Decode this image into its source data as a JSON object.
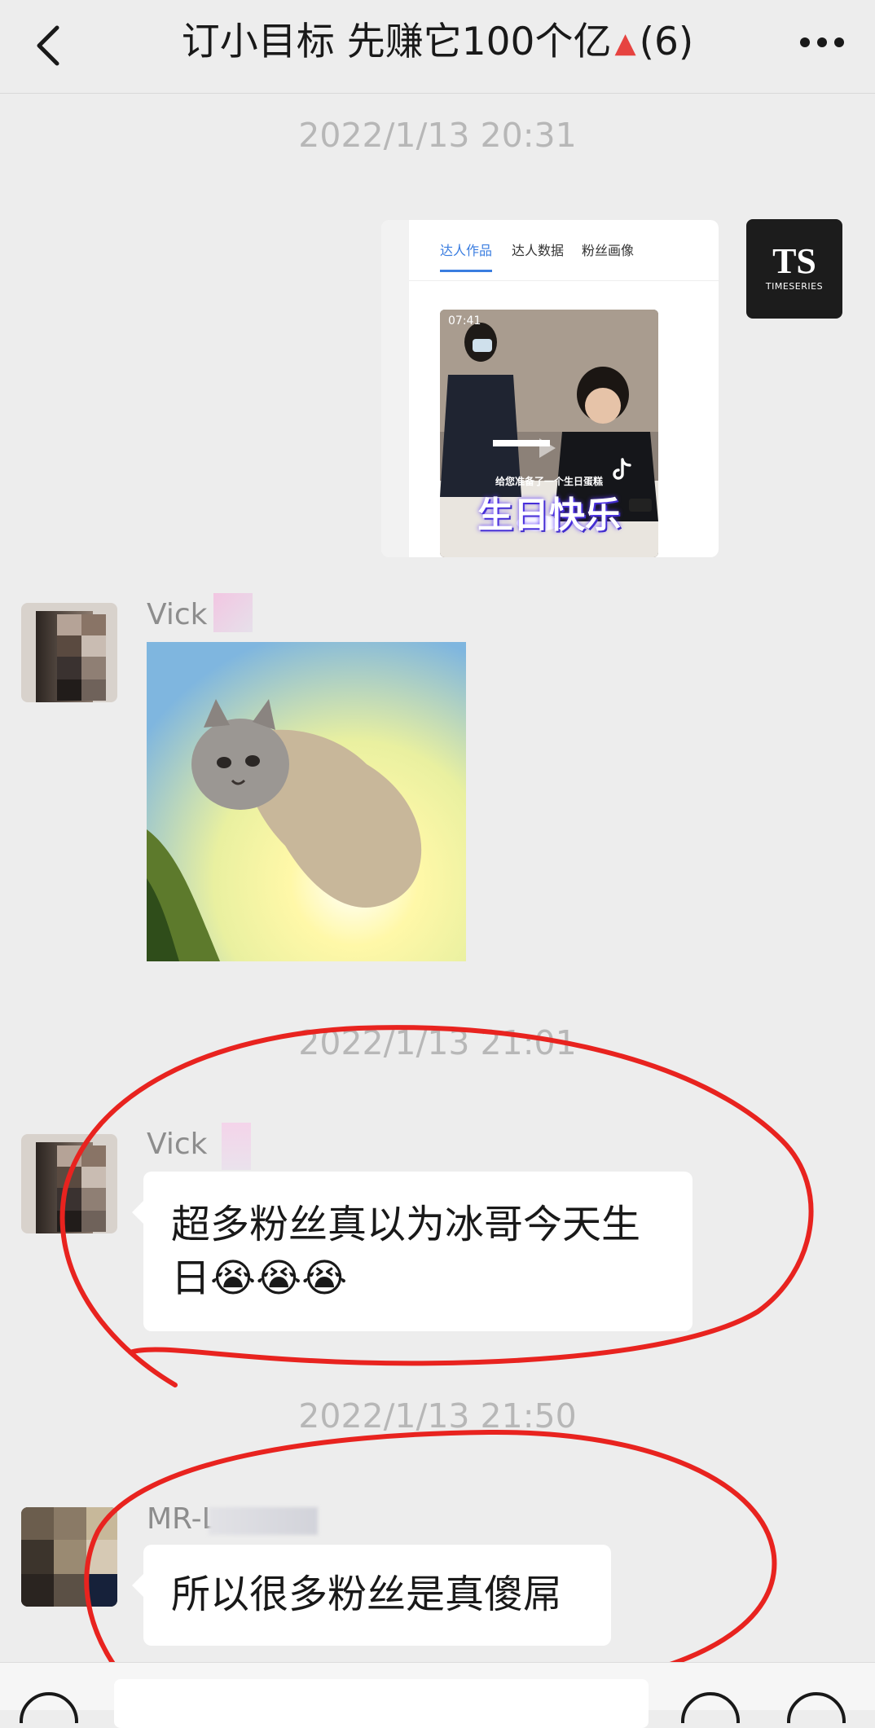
{
  "header": {
    "title": "订小目标 先赚它100个亿",
    "title_icon": "red-triangle",
    "member_count": "(6)"
  },
  "timestamps": [
    "2022/1/13 20:31",
    "2022/1/13 21:01",
    "2022/1/13 21:50"
  ],
  "messages": [
    {
      "type": "shared-card",
      "card": {
        "tabs": [
          "达人作品",
          "达人数据",
          "粉丝画像"
        ],
        "video_duration": "07:41",
        "video_caption_small": "给您准备了一个生日蛋糕",
        "video_caption_big": "生日快乐"
      },
      "sender_logo_text": "TIMESERIES"
    },
    {
      "type": "image",
      "sender": "Vick",
      "image": "cat-meme"
    },
    {
      "type": "text",
      "sender": "Vick",
      "text": "超多粉丝真以为冰哥今天生日😭😭😭"
    },
    {
      "type": "text",
      "sender": "MR-L",
      "text": "所以很多粉丝是真傻屌"
    }
  ],
  "colors": {
    "annotation": "#e8231f",
    "background": "#ededed",
    "tab_active": "#3a7de0"
  }
}
